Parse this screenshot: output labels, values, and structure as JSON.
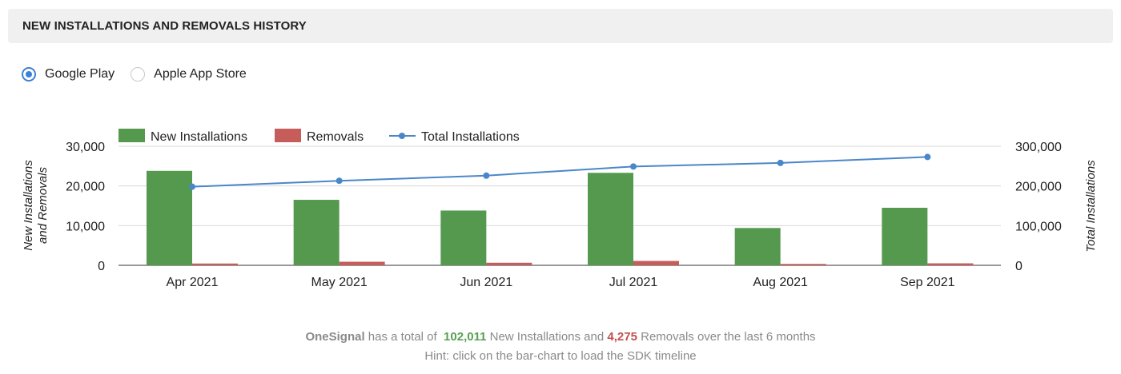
{
  "header": {
    "title": "NEW INSTALLATIONS AND REMOVALS HISTORY"
  },
  "store_selector": {
    "options": [
      {
        "label": "Google Play",
        "selected": true
      },
      {
        "label": "Apple App Store",
        "selected": false
      }
    ]
  },
  "chart_data": {
    "type": "bar",
    "categories": [
      "Apr 2021",
      "May 2021",
      "Jun 2021",
      "Jul 2021",
      "Aug 2021",
      "Sep 2021"
    ],
    "series": [
      {
        "name": "New Installations",
        "type": "bar",
        "axis": "left",
        "color": "#55994f",
        "values": [
          23800,
          16500,
          13800,
          23300,
          9400,
          14500
        ]
      },
      {
        "name": "Removals",
        "type": "bar",
        "axis": "left",
        "color": "#c65d5a",
        "values": [
          450,
          900,
          650,
          1100,
          350,
          500
        ]
      },
      {
        "name": "Total Installations",
        "type": "line",
        "axis": "right",
        "color": "#4a87c9",
        "values": [
          198000,
          213000,
          226000,
          249000,
          258000,
          273000
        ]
      }
    ],
    "ylabel": "New Installations and Removals",
    "y2label": "Total Installations",
    "ylim": [
      0,
      30000
    ],
    "y2lim": [
      0,
      300000
    ],
    "yticks": [
      "0",
      "10,000",
      "20,000",
      "30,000"
    ],
    "y2ticks": [
      "0",
      "100,000",
      "200,000",
      "300,000"
    ],
    "grid": true,
    "legend_position": "top-left"
  },
  "summary": {
    "brand": "OneSignal",
    "text1": "has a total of",
    "installs": "102,011",
    "text2": "New Installations and",
    "removals": "4,275",
    "text3": "Removals over the last 6 months",
    "hint": "Hint: click on the bar-chart to load the SDK timeline"
  }
}
